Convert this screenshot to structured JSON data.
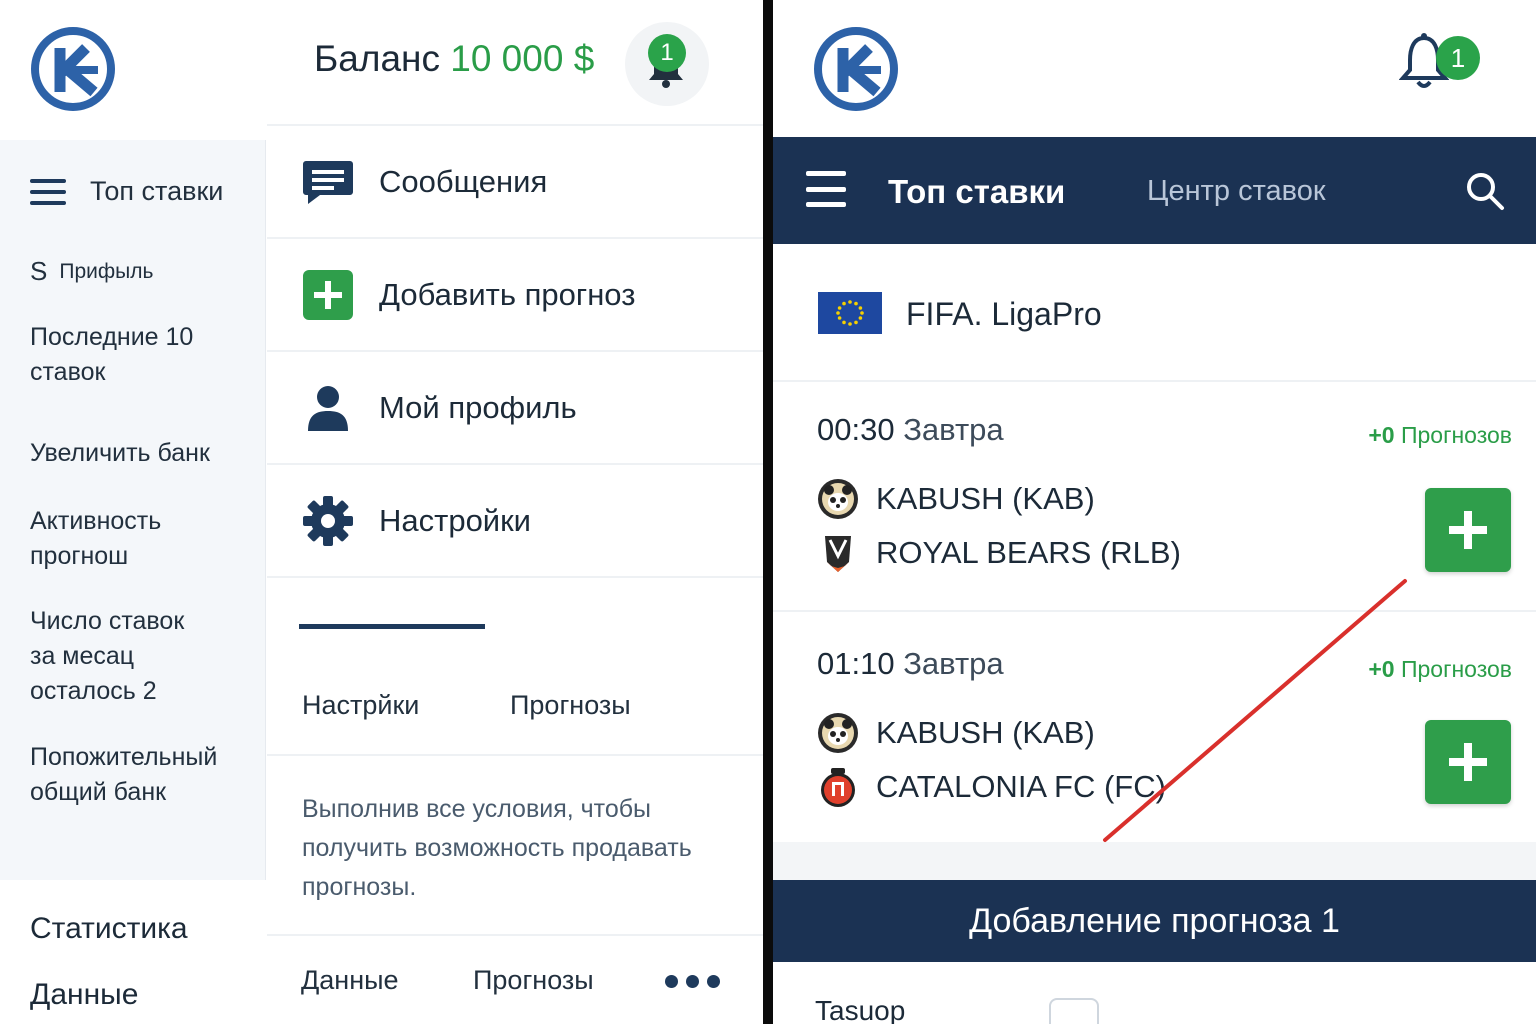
{
  "sidebar": {
    "top_bets": "Топ ставки",
    "profit_symbol": "S",
    "profit": "Прифыль",
    "last_bets_line1": "Последние 10",
    "last_bets_line2": "ставок",
    "increase_bank": "Увеличить банк",
    "activity_line1": "Активность",
    "activity_line2": "прогнош",
    "bets_left_line1": "Число ставок",
    "bets_left_line2": "за месац",
    "bets_left_line3": "осталось 2",
    "positive_line1": "Попожительный",
    "positive_line2": "общий банк",
    "statistics": "Статистика",
    "data": "Данные"
  },
  "menu": {
    "balance_label": "Баланс",
    "balance_value": "10 000 $",
    "notification_count": "1",
    "items": [
      {
        "label": "Сообщения",
        "icon": "message-icon"
      },
      {
        "label": "Добавить прогноз",
        "icon": "plus-square-icon"
      },
      {
        "label": "Мой профиль",
        "icon": "user-icon"
      },
      {
        "label": "Настройки",
        "icon": "gear-icon"
      }
    ],
    "tabs": [
      "Настрйки",
      "Прогнозы"
    ],
    "note": "Выполнив все условия, чтобы получить возможность продавать прогнозы.",
    "bottom_tabs": [
      "Данные",
      "Прогнозы"
    ]
  },
  "phone": {
    "notification_count": "1",
    "nav": {
      "top": "Топ ставки",
      "center": "Центр ставок"
    },
    "league": "FIFA. LigaPro",
    "matches": [
      {
        "time": "00:30",
        "day": "Завтра",
        "forecast_count": "+0",
        "forecast_label": "Прогнозов",
        "team1": "KABUSH (KAB)",
        "team2": "ROYAL BEARS (RLB)"
      },
      {
        "time": "01:10",
        "day": "Завтра",
        "forecast_count": "+0",
        "forecast_label": "Прогнозов",
        "team1": "KABUSH (KAB)",
        "team2": "CATALONIA FC (FC)"
      }
    ],
    "add_header": "Добавление прогноза 1",
    "form_label": "Tasuop"
  },
  "colors": {
    "navy": "#1b3253",
    "green": "#2f9e4b",
    "balance_green": "#2a9d48",
    "annotation_red": "#d9302c"
  }
}
